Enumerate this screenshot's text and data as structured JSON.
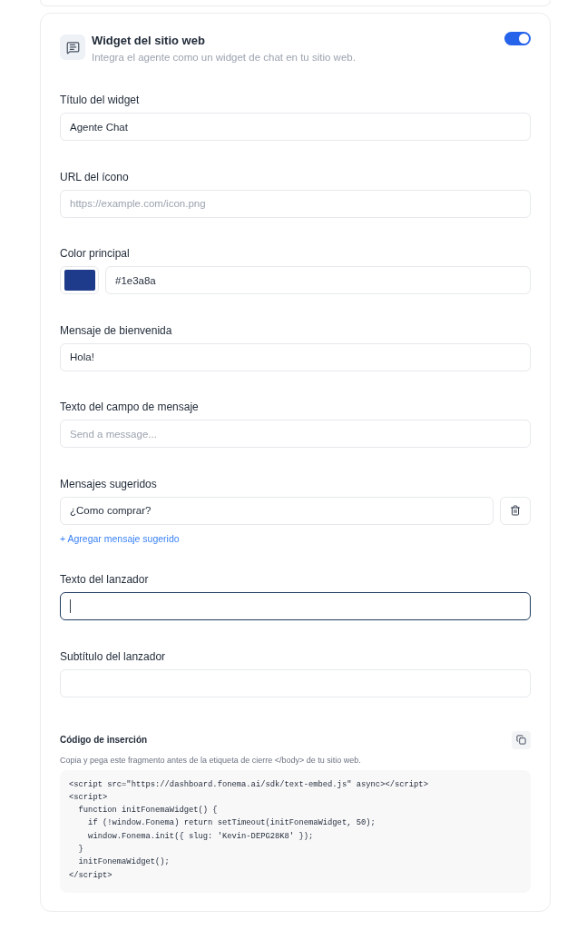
{
  "section": {
    "title": "Widget del sitio web",
    "description": "Integra el agente como un widget de chat en tu sitio web.",
    "enabled": true
  },
  "fields": [
    {
      "kind": "text",
      "label": "Título del widget",
      "value": "Agente Chat",
      "focused": false
    },
    {
      "kind": "text",
      "label": "URL del ícono",
      "placeholder": "https://example.com/icon.png",
      "focused": false
    },
    {
      "kind": "color",
      "label": "Color principal",
      "color": "#1e3a8a",
      "value": "#1e3a8a",
      "focused": false
    },
    {
      "kind": "text",
      "label": "Mensaje de bienvenida",
      "value": "Hola!",
      "focused": false
    },
    {
      "kind": "text",
      "label": "Texto del campo de mensaje",
      "placeholder": "Send a message...",
      "focused": false
    },
    {
      "kind": "list",
      "label": "Mensajes sugeridos",
      "items": [
        {
          "value": "¿Como comprar?",
          "focused": false
        }
      ],
      "add_link": "+ Agregar mensaje sugerido"
    },
    {
      "kind": "text",
      "label": "Texto del lanzador",
      "focused": true
    },
    {
      "kind": "text",
      "label": "Subtítulo del lanzador",
      "focused": false
    }
  ],
  "embed": {
    "title": "Código de inserción",
    "description": "Copia y pega este fragmento antes de la etiqueta de cierre </body> de tu sitio web.",
    "code": "<script src=\"https://dashboard.fonema.ai/sdk/text-embed.js\" async></script>\n<script>\n  function initFonemaWidget() {\n    if (!window.Fonema) return setTimeout(initFonemaWidget, 50);\n    window.Fonema.init({ slug: 'Kevin-DEPG28K8' });\n  }\n  initFonemaWidget();\n</script>"
  }
}
